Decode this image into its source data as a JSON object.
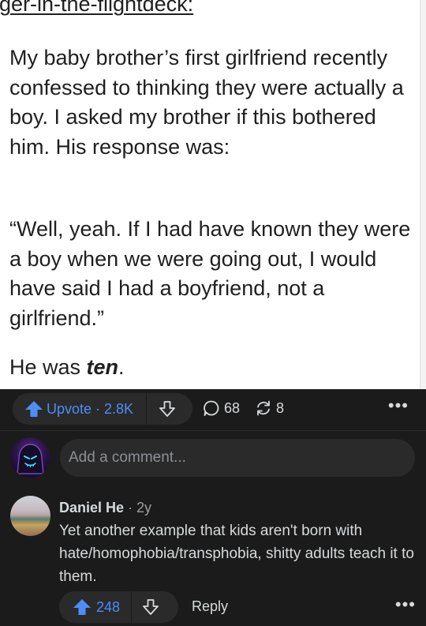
{
  "post": {
    "username": "ger-in-the-flightdeck:",
    "paragraph1": "My baby brother’s first girlfriend recently confessed to thinking they were actually a boy. I asked my brother if this bothered him. His response was:",
    "paragraph2": "“Well, yeah. If I had have known they were a boy when we were going out, I would have said I had a boyfriend, not a girlfriend.”",
    "paragraph3_prefix": "He was ",
    "paragraph3_emphasis": "ten",
    "paragraph3_suffix": "."
  },
  "action_bar": {
    "upvote_label": "Upvote · 2.8K",
    "comments_count": "68",
    "shares_count": "8",
    "more_label": "•••"
  },
  "composer": {
    "placeholder": "Add a comment..."
  },
  "comment": {
    "author": "Daniel He",
    "time": " · 2y",
    "body": "Yet another example that kids aren't born with hate/homophobia/transphobia, shitty adults teach it to them.",
    "upvotes": "248",
    "reply_label": "Reply",
    "more_label": "•••"
  },
  "colors": {
    "accent_blue": "#4e8df5",
    "background": "#1b1b1b",
    "pill": "#2a2a2b",
    "text": "#d7dadc"
  },
  "icons": [
    "upvote-arrow-icon",
    "downvote-arrow-icon",
    "comment-bubble-icon",
    "share-icon",
    "more-dots-icon"
  ]
}
